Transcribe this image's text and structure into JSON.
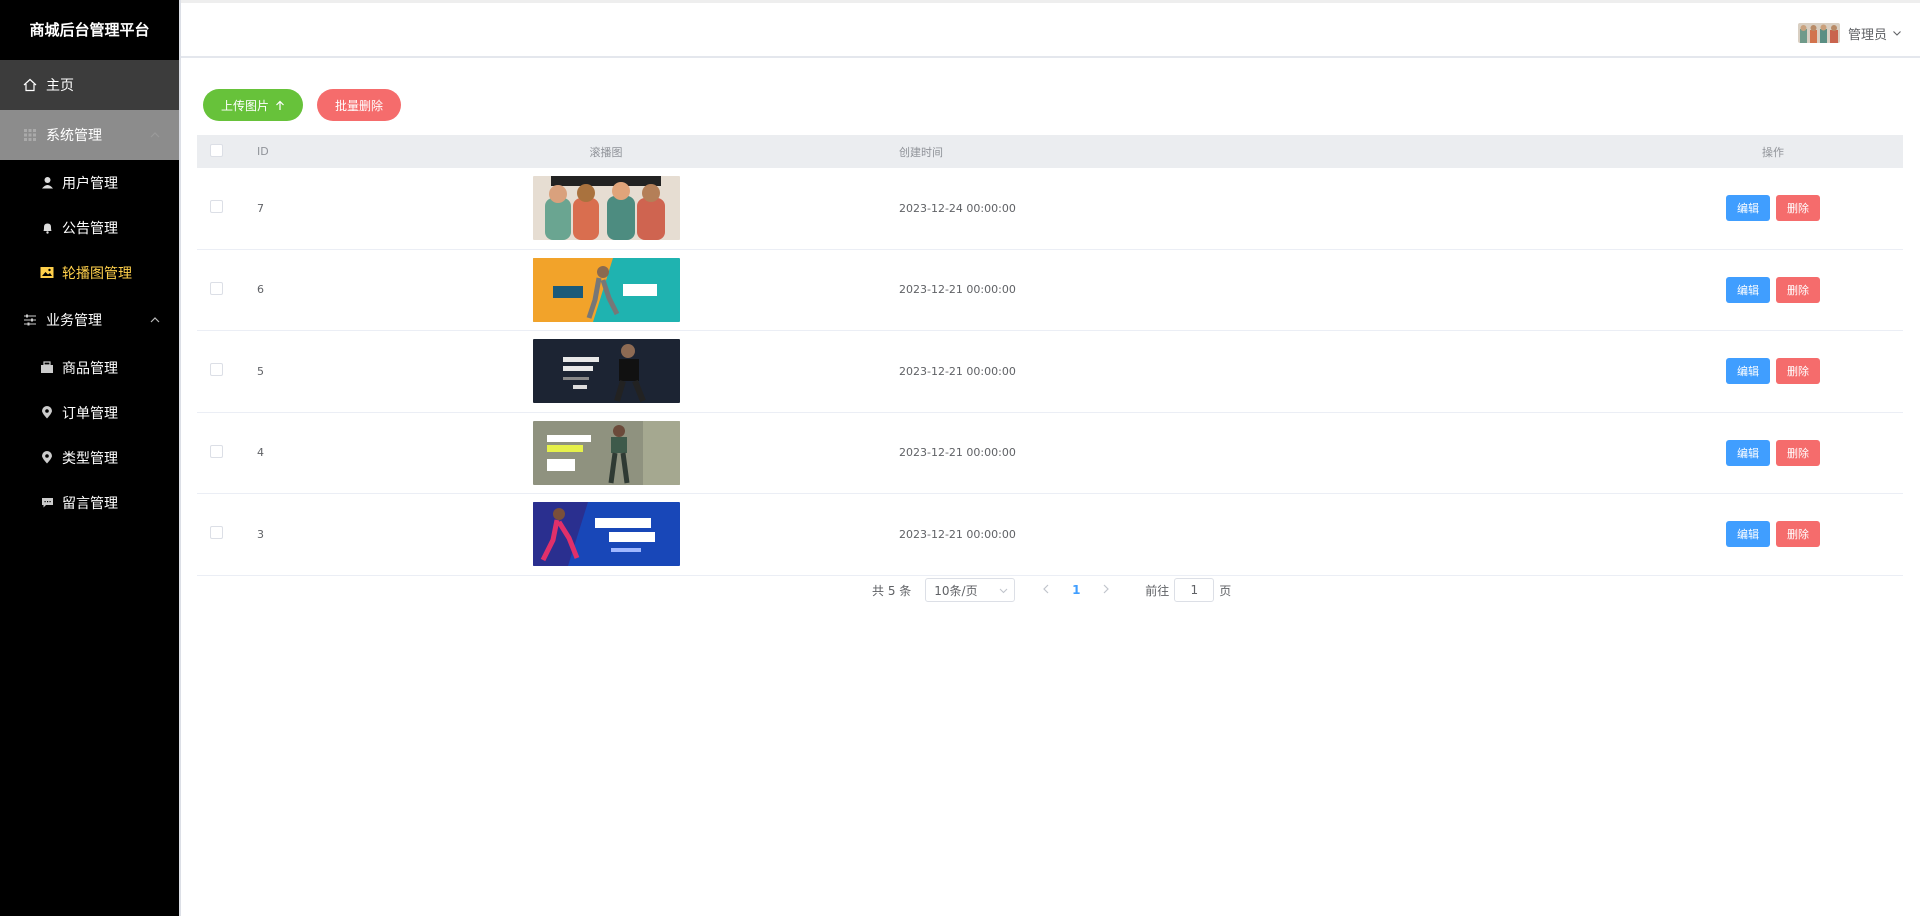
{
  "sidebar": {
    "title": "商城后台管理平台",
    "home": "主页",
    "system_group": "系统管理",
    "system_items": [
      {
        "label": "用户管理",
        "icon": "user-icon"
      },
      {
        "label": "公告管理",
        "icon": "bell-icon"
      },
      {
        "label": "轮播图管理",
        "icon": "picture-icon"
      }
    ],
    "business_group": "业务管理",
    "business_items": [
      {
        "label": "商品管理",
        "icon": "goods-icon"
      },
      {
        "label": "订单管理",
        "icon": "location-icon"
      },
      {
        "label": "类型管理",
        "icon": "location-icon"
      },
      {
        "label": "留言管理",
        "icon": "message-icon"
      }
    ]
  },
  "header": {
    "user_label": "管理员"
  },
  "toolbar": {
    "upload_label": "上传图片",
    "batch_delete_label": "批量删除"
  },
  "table": {
    "columns": {
      "id": "ID",
      "image": "滚播图",
      "created": "创建时间",
      "ops": "操作"
    },
    "rows": [
      {
        "id": "7",
        "created": "2023-12-24 00:00:00"
      },
      {
        "id": "6",
        "created": "2023-12-21 00:00:00"
      },
      {
        "id": "5",
        "created": "2023-12-21 00:00:00"
      },
      {
        "id": "4",
        "created": "2023-12-21 00:00:00"
      },
      {
        "id": "3",
        "created": "2023-12-21 00:00:00"
      }
    ],
    "edit_label": "编辑",
    "delete_label": "删除"
  },
  "pagination": {
    "total_text": "共 5 条",
    "page_size": "10条/页",
    "current_page": "1",
    "goto_prefix": "前往",
    "goto_value": "1",
    "goto_suffix": "页"
  },
  "colors": {
    "sidebar_bg": "#000000",
    "active_menu": "#ffd04b",
    "primary": "#409eff",
    "success": "#67c23a",
    "danger": "#f56c6c"
  }
}
